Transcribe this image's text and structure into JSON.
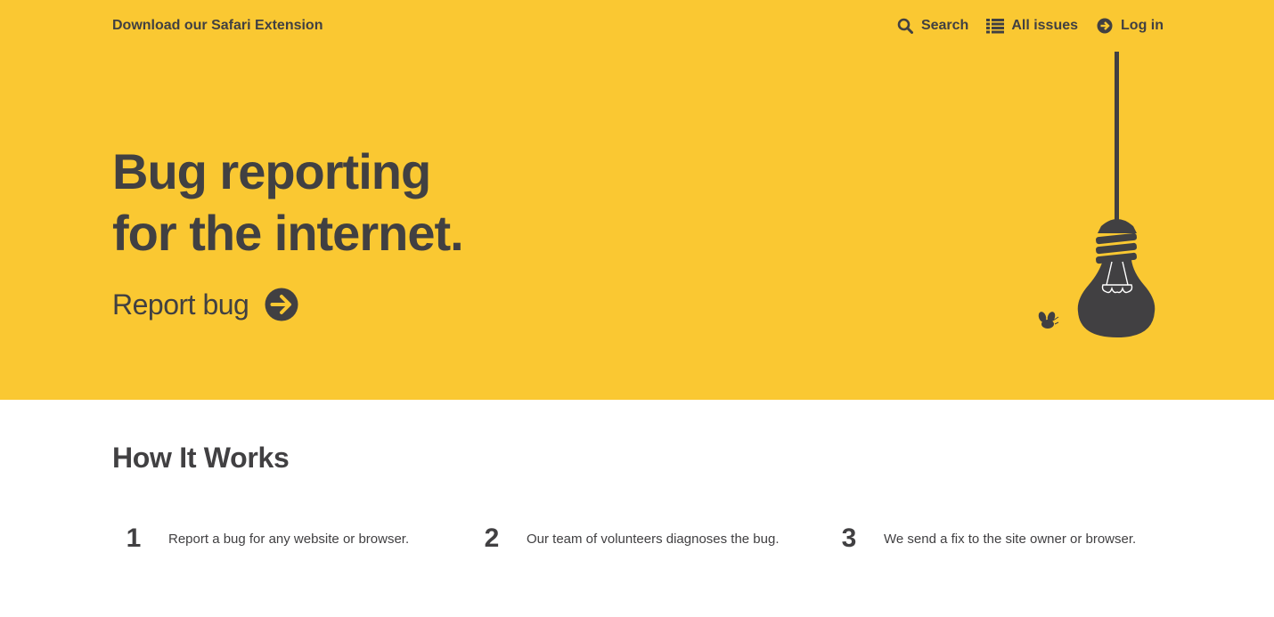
{
  "header": {
    "extension_link": "Download our Safari Extension",
    "nav": [
      {
        "label": "Search",
        "icon": "search-icon"
      },
      {
        "label": "All issues",
        "icon": "list-icon"
      },
      {
        "label": "Log in",
        "icon": "arrow-circle-right-icon"
      }
    ]
  },
  "hero": {
    "title_line1": "Bug reporting",
    "title_line2": "for the internet.",
    "cta_label": "Report bug",
    "background_color": "#fac832",
    "text_color": "#414042"
  },
  "how_it_works": {
    "heading": "How It Works",
    "steps": [
      {
        "number": "1",
        "text": "Report a bug for any website or browser."
      },
      {
        "number": "2",
        "text": "Our team of volunteers diagnoses the bug."
      },
      {
        "number": "3",
        "text": "We send a fix to the site owner or browser."
      }
    ]
  }
}
